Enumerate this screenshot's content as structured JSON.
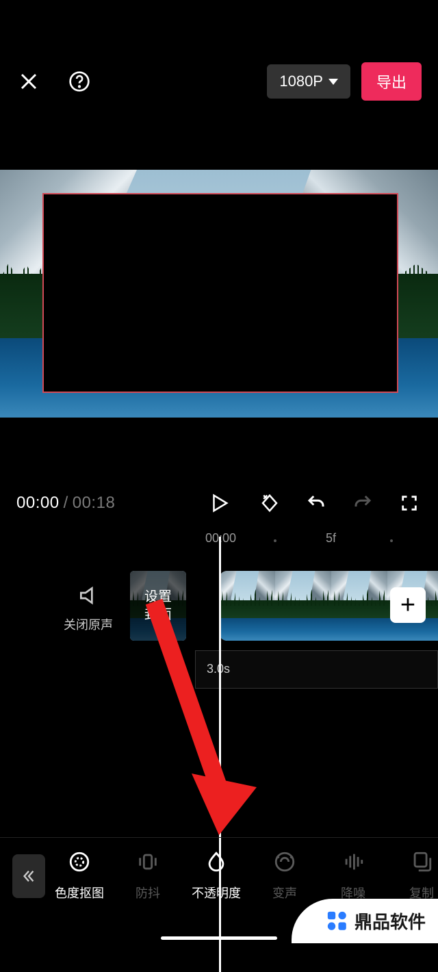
{
  "topbar": {
    "resolution": "1080P",
    "export": "导出"
  },
  "transport": {
    "current": "00:00",
    "duration": "00:18"
  },
  "ruler": {
    "t0": "00:00",
    "t1": "5f"
  },
  "timeline": {
    "mute_label": "关闭原声",
    "cover_label": "设置\n封面",
    "audio_duration": "3.0s",
    "add_label": "+"
  },
  "toolbar": {
    "items": [
      {
        "label": "色度抠图",
        "active": true,
        "name": "tool-chroma"
      },
      {
        "label": "防抖",
        "active": false,
        "name": "tool-stabilize"
      },
      {
        "label": "不透明度",
        "active": true,
        "name": "tool-opacity"
      },
      {
        "label": "变声",
        "active": false,
        "name": "tool-voicefx"
      },
      {
        "label": "降噪",
        "active": false,
        "name": "tool-denoise"
      },
      {
        "label": "复制",
        "active": false,
        "name": "tool-copy"
      }
    ]
  },
  "watermark": "鼎品软件"
}
